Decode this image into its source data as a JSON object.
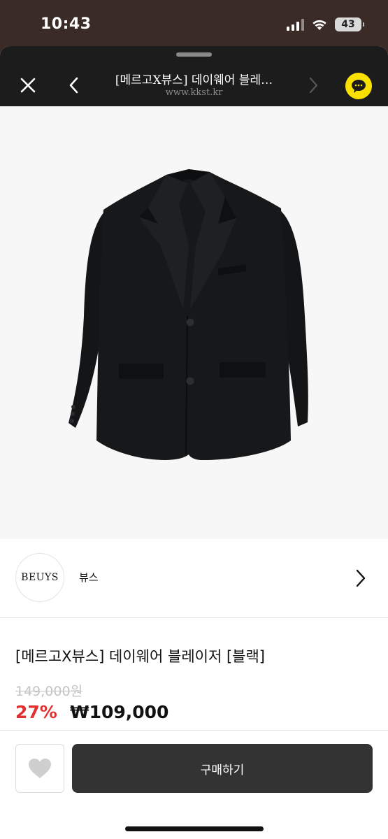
{
  "status_bar": {
    "time": "10:43",
    "battery": "43",
    "icons": [
      "signal-icon",
      "wifi-icon",
      "battery-icon"
    ]
  },
  "browser": {
    "title": "[메르고X뷰스] 데이웨어 블레…",
    "url": "www.kkst.kr",
    "icons": [
      "close-icon",
      "back-icon",
      "forward-icon",
      "kakaotalk-icon"
    ],
    "accent_color": "#fae100"
  },
  "product": {
    "image_subject": "black-blazer",
    "brand_logo_text": "BEUYS",
    "brand_name": "뷰스",
    "name": "[메르고X뷰스] 데이웨어 블레이저 [블랙]",
    "original_price": "149,000원",
    "discount_rate": "27%",
    "sale_price": "₩109,000",
    "discount_color": "#e03131"
  },
  "actions": {
    "buy_label": "구매하기",
    "icons": [
      "heart-icon",
      "chevron-right-icon"
    ]
  }
}
